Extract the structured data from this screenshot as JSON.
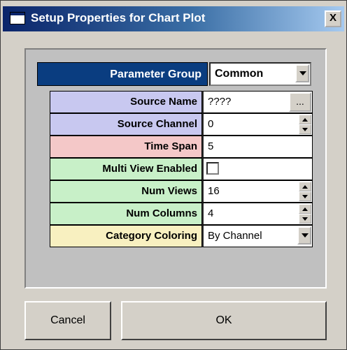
{
  "window": {
    "title": "Setup Properties for Chart Plot",
    "close_label": "X"
  },
  "parameter_group": {
    "label": "Parameter Group",
    "value": "Common"
  },
  "rows": [
    {
      "label": "Source Name",
      "value": "????",
      "bg": "#c8c8f0",
      "control": "ellipsis",
      "button_label": "..."
    },
    {
      "label": "Source Channel",
      "value": "0",
      "bg": "#c8c8f0",
      "control": "spin"
    },
    {
      "label": "Time Span",
      "value": "5",
      "bg": "#f4c8c8",
      "control": "none"
    },
    {
      "label": "Multi View Enabled",
      "value": "",
      "bg": "#c8f0c8",
      "control": "checkbox",
      "checked": false
    },
    {
      "label": "Num Views",
      "value": "16",
      "bg": "#c8f0c8",
      "control": "spin"
    },
    {
      "label": "Num Columns",
      "value": "4",
      "bg": "#c8f0c8",
      "control": "spin"
    },
    {
      "label": "Category Coloring",
      "value": "By Channel",
      "bg": "#f8f0c0",
      "control": "dropdown"
    }
  ],
  "buttons": {
    "cancel": "Cancel",
    "ok": "OK"
  }
}
